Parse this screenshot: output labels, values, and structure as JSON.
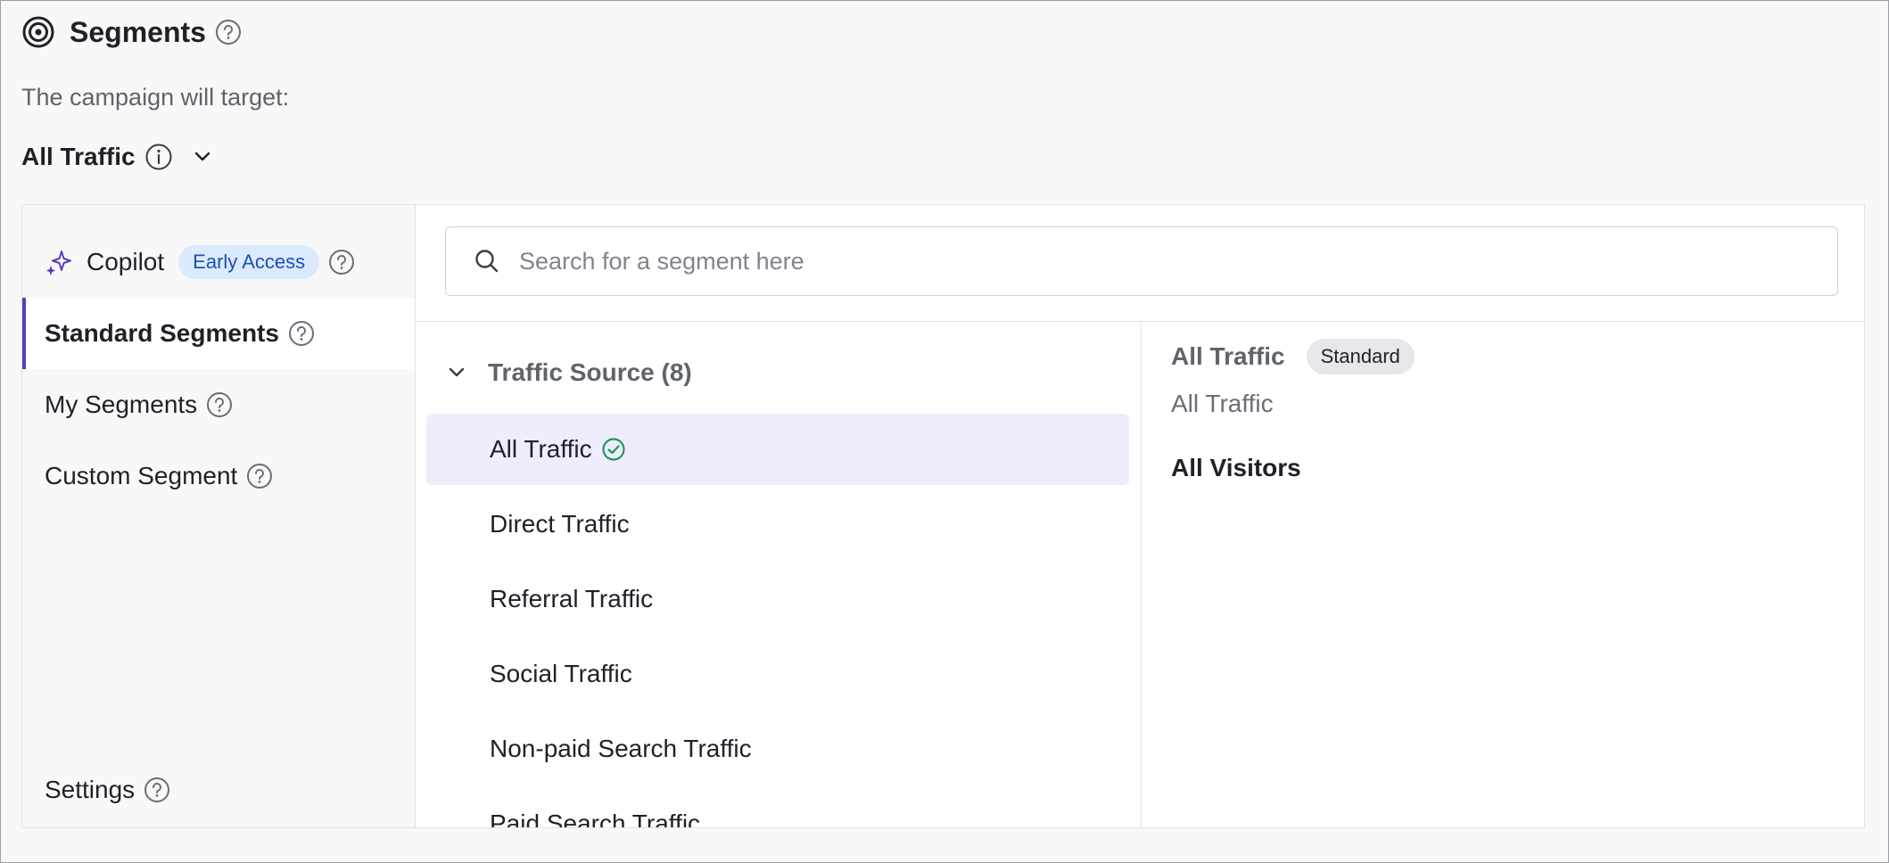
{
  "header": {
    "title": "Segments",
    "icon": "target-icon"
  },
  "subtitle": "The campaign will target:",
  "target": {
    "value": "All Traffic"
  },
  "sidebar": {
    "copilot": {
      "label": "Copilot",
      "badge": "Early Access"
    },
    "items": [
      {
        "label": "Standard Segments",
        "active": true
      },
      {
        "label": "My Segments"
      },
      {
        "label": "Custom Segment"
      }
    ],
    "settings": {
      "label": "Settings"
    }
  },
  "search": {
    "placeholder": "Search for a segment here",
    "value": ""
  },
  "group": {
    "label": "Traffic Source (8)",
    "expanded": true
  },
  "segments": [
    {
      "label": "All Traffic",
      "selected": true
    },
    {
      "label": "Direct Traffic"
    },
    {
      "label": "Referral Traffic"
    },
    {
      "label": "Social Traffic"
    },
    {
      "label": "Non-paid Search Traffic"
    },
    {
      "label": "Paid Search Traffic"
    }
  ],
  "detail": {
    "name": "All Traffic",
    "badge": "Standard",
    "description": "All Traffic",
    "audience": "All Visitors"
  },
  "colors": {
    "accent": "#5b3fb6",
    "selected_bg": "#efecfd",
    "check": "#1a9a5b",
    "badge_bg": "#dbeafd"
  }
}
